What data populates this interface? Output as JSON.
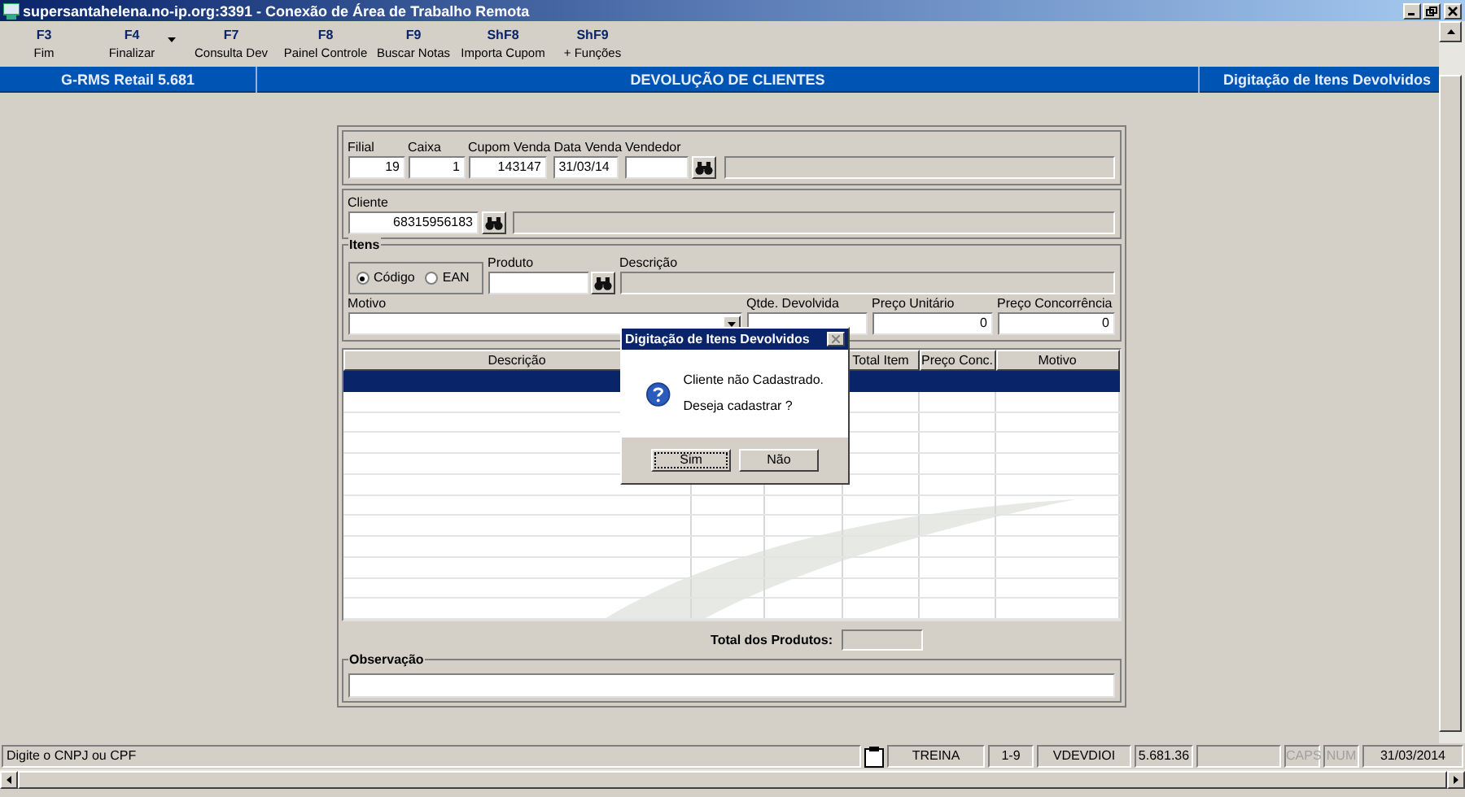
{
  "window": {
    "title": "supersantahelena.no-ip.org:3391 - Conexão de Área de Trabalho Remota"
  },
  "toolbar": {
    "buttons": [
      {
        "key": "F3",
        "label": "Fim",
        "dropdown": false
      },
      {
        "key": "F4",
        "label": "Finalizar",
        "dropdown": true
      },
      {
        "key": "F7",
        "label": "Consulta Dev",
        "dropdown": false
      },
      {
        "key": "F8",
        "label": "Painel Controle",
        "dropdown": false
      },
      {
        "key": "F9",
        "label": "Buscar Notas",
        "dropdown": false
      },
      {
        "key": "ShF8",
        "label": "Importa Cupom",
        "dropdown": false
      },
      {
        "key": "ShF9",
        "label": "+ Funções",
        "dropdown": false
      }
    ]
  },
  "header": {
    "app": "G-RMS Retail 5.681",
    "title": "DEVOLUÇÃO DE CLIENTES",
    "screen": "Digitação de Itens Devolvidos"
  },
  "sale": {
    "fields": [
      {
        "label": "Filial",
        "value": "19"
      },
      {
        "label": "Caixa",
        "value": "1"
      },
      {
        "label": "Cupom Venda",
        "value": "143147"
      },
      {
        "label": "Data Venda",
        "value": "31/03/14"
      },
      {
        "label": "Vendedor"
      }
    ]
  },
  "customer": {
    "label": "Cliente",
    "value": "68315956183"
  },
  "items": {
    "title": "Itens",
    "options": [
      {
        "label": "Código",
        "selected": true
      },
      {
        "label": "EAN",
        "selected": false
      }
    ],
    "product_label": "Produto",
    "description_label": "Descrição",
    "reason_label": "Motivo",
    "qty_label": "Qtde. Devolvida",
    "unit_price_label": "Preço Unitário",
    "unit_price": "0",
    "competitor_price_label": "Preço Concorrência",
    "competitor_price": "0"
  },
  "table": {
    "columns": [
      "Descrição",
      "Total Item",
      "Preço Conc.",
      "Motivo"
    ],
    "rows": [
      {
        "selected": true
      },
      {
        "selected": false
      },
      {
        "selected": false
      },
      {
        "selected": false
      },
      {
        "selected": false
      },
      {
        "selected": false
      },
      {
        "selected": false
      },
      {
        "selected": false
      },
      {
        "selected": false
      },
      {
        "selected": false
      },
      {
        "selected": false
      },
      {
        "selected": false
      }
    ]
  },
  "total_label": "Total dos Produtos:",
  "observation_label": "Observação",
  "status_bar": {
    "message": "Digite o CNPJ ou CPF",
    "segments": [
      "TREINA",
      "1-9",
      "VDEVDIOI",
      "5.681.36"
    ],
    "indicators": [
      {
        "label": "CAPS",
        "on": false
      },
      {
        "label": "NUM",
        "on": false
      }
    ],
    "date": "31/03/2014"
  },
  "dialog": {
    "title": "Digitação de Itens Devolvidos",
    "lines": [
      "Cliente não Cadastrado.",
      "Deseja cadastrar ?"
    ],
    "buttons": [
      {
        "label": "Sim",
        "focused": true
      },
      {
        "label": "Não",
        "focused": false
      }
    ]
  }
}
